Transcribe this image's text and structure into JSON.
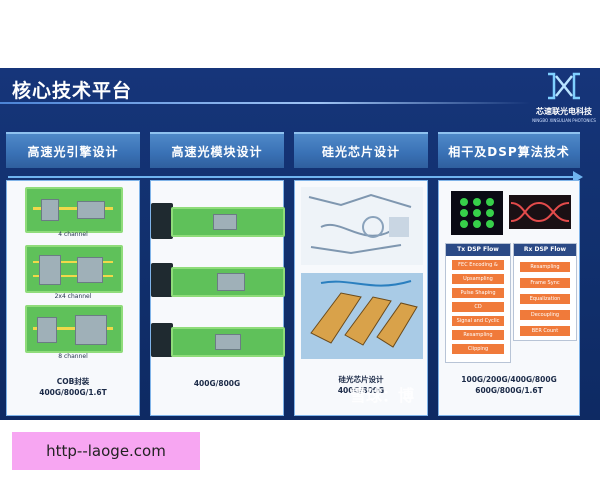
{
  "slide": {
    "title": "核心技术平台",
    "logo": {
      "name_cn": "芯速联光电科技",
      "name_en": "NINGBO XINSULIAN PHOTONICS"
    },
    "tabs": [
      "高速光引擎设计",
      "高速光模块设计",
      "硅光芯片设计",
      "相干及DSP算法技术"
    ],
    "panels": [
      {
        "labels": [
          "4 channel",
          "2x4 channel",
          "8 channel"
        ],
        "caption_1": "COB封装",
        "caption_2": "400G/800G/1.6T"
      },
      {
        "caption_1": "400G/800G"
      },
      {
        "caption_1": "硅光芯片设计",
        "caption_2": "400G/800G"
      },
      {
        "tx_flow": {
          "title": "Tx DSP Flow",
          "steps": [
            "FEC Encoding & PAM4 Mapping",
            "Upsampling",
            "Pulse Shaping",
            "CD Precompensation",
            "Signal and Cyclic Adjustment",
            "Resampling",
            "Clipping"
          ]
        },
        "rx_flow": {
          "title": "Rx DSP Flow",
          "steps": [
            "Resampling",
            "Frame Sync",
            "Equalization",
            "Decoupling",
            "BER Count"
          ]
        },
        "caption_1": "100G/200G/400G/800G",
        "caption_2": "600G/800G/1.6T"
      }
    ],
    "watermark": "雪球：博"
  },
  "overlay": {
    "link_text": "http--laoge.com"
  },
  "colors": {
    "slide_bg": "#16357a",
    "tab_bg": "#3a72b6",
    "board_green": "#5fc15a",
    "overlay_pink": "#f7a6f2"
  }
}
